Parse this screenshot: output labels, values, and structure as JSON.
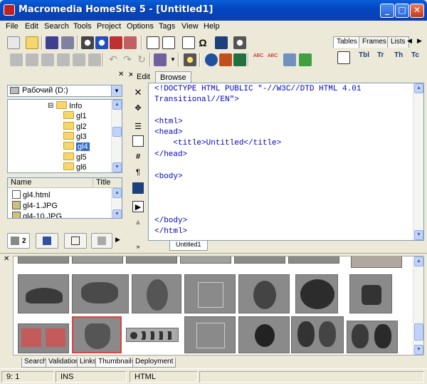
{
  "window": {
    "title": "Macromedia HomeSite 5 - [Untitled1]",
    "minimize": "_",
    "maximize": "□",
    "close": "✕"
  },
  "menu": [
    "File",
    "Edit",
    "Search",
    "Tools",
    "Project",
    "Options",
    "Tags",
    "View",
    "Help"
  ],
  "tag_tabs": [
    "Tables",
    "Frames",
    "Lists"
  ],
  "tag_nav": {
    "prev": "◀",
    "next": "▶"
  },
  "sidebar": {
    "drive": "Рабочий (D:)",
    "tree": [
      {
        "label": "Info",
        "expand": "⊟"
      },
      {
        "label": "gl1"
      },
      {
        "label": "gl2"
      },
      {
        "label": "gl3"
      },
      {
        "label": "gl4",
        "selected": true
      },
      {
        "label": "gl5"
      },
      {
        "label": "gl6"
      }
    ],
    "files_columns": [
      "Name",
      "Title"
    ],
    "files": [
      "gl4.html",
      "gl4-1.JPG",
      "gl4-10.JPG"
    ],
    "bottom_tab_badge": "2"
  },
  "editor": {
    "tabs": [
      "Edit",
      "Browse"
    ],
    "doc_tab": "Untitled1",
    "code_lines": [
      "<!DOCTYPE HTML PUBLIC \"-//W3C//DTD HTML 4.01",
      "Transitional//EN\">",
      "",
      "<html>",
      "<head>",
      "    <title>Untitled</title>",
      "</head>",
      "",
      "<body>",
      "",
      "",
      "",
      "",
      "</body>",
      "</html>"
    ]
  },
  "results": {
    "tabs": [
      "Search",
      "Validation",
      "Links",
      "Thumbnails",
      "Deployment"
    ],
    "active_tab": "Thumbnails"
  },
  "status": {
    "position": "9: 1",
    "mode": "INS",
    "doc_type": "HTML"
  },
  "colors": {
    "titlebar": "#0a5fd8",
    "panel": "#ece9d8",
    "code_blue": "#0000c0"
  }
}
